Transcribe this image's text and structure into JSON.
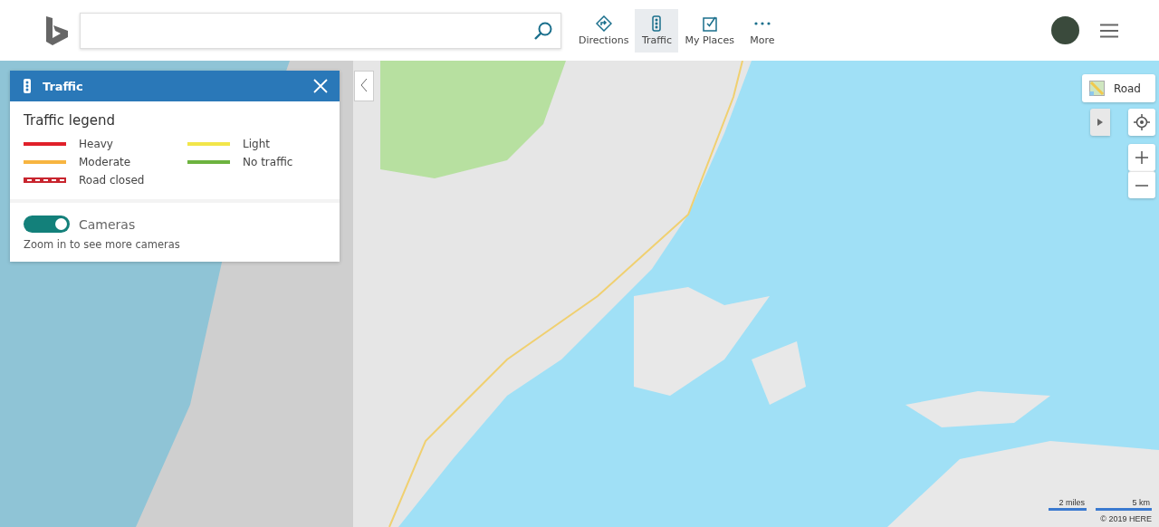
{
  "nav": [
    {
      "label": "Directions",
      "selected": false
    },
    {
      "label": "Traffic",
      "selected": true
    },
    {
      "label": "My Places",
      "selected": false
    },
    {
      "label": "More",
      "selected": false
    }
  ],
  "traffic_panel": {
    "title": "Traffic",
    "legend_title": "Traffic legend",
    "legend": [
      {
        "label": "Heavy",
        "color": "#e0202a",
        "kind": "solid"
      },
      {
        "label": "Light",
        "color": "#f2e64a",
        "kind": "solid"
      },
      {
        "label": "Moderate",
        "color": "#f7b541",
        "kind": "solid"
      },
      {
        "label": "No traffic",
        "color": "#6db33f",
        "kind": "solid"
      },
      {
        "label": "Road closed",
        "color": "#c8252e",
        "kind": "dashed"
      }
    ],
    "cameras": {
      "label": "Cameras",
      "on": true,
      "note": "Zoom in to see more cameras"
    }
  },
  "map_style": {
    "label": "Road"
  },
  "scale": {
    "miles": "2 miles",
    "km": "5 km"
  },
  "copyright": "© 2019 HERE"
}
